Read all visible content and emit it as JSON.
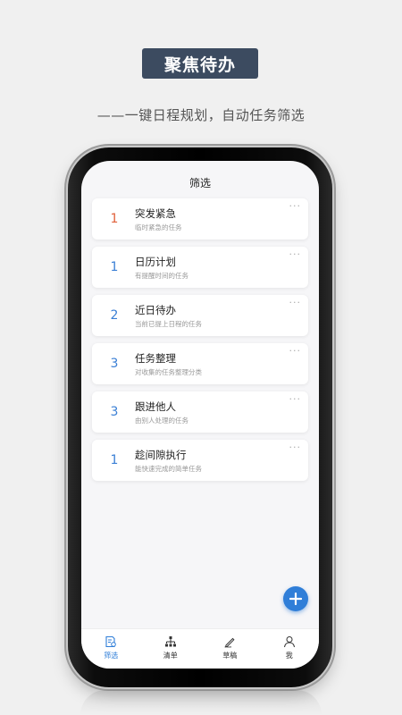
{
  "promo": {
    "title": "聚焦待办",
    "subtitle": "——一键日程规划，自动任务筛选"
  },
  "screen": {
    "title": "筛选"
  },
  "tasks": [
    {
      "count": "1",
      "name": "突发紧急",
      "desc": "临时紧急的任务",
      "count_color": "#e0613a",
      "more": "···"
    },
    {
      "count": "1",
      "name": "日历计划",
      "desc": "有提醒时间的任务",
      "count_color": "#3a7fd5",
      "more": "···"
    },
    {
      "count": "2",
      "name": "近日待办",
      "desc": "当前已提上日程的任务",
      "count_color": "#3a7fd5",
      "more": "···"
    },
    {
      "count": "3",
      "name": "任务整理",
      "desc": "对收集的任务整理分类",
      "count_color": "#3a7fd5",
      "more": "···"
    },
    {
      "count": "3",
      "name": "跟进他人",
      "desc": "由别人处理的任务",
      "count_color": "#3a7fd5",
      "more": "···"
    },
    {
      "count": "1",
      "name": "趁间隙执行",
      "desc": "能快速完成的简单任务",
      "count_color": "#3a7fd5",
      "more": "···"
    }
  ],
  "fab": {
    "icon": "plus-icon"
  },
  "tabbar": [
    {
      "label": "筛选",
      "icon": "filter-doc-icon",
      "active": true
    },
    {
      "label": "清单",
      "icon": "tree-list-icon",
      "active": false
    },
    {
      "label": "草稿",
      "icon": "pen-icon",
      "active": false
    },
    {
      "label": "我",
      "icon": "person-icon",
      "active": false
    }
  ],
  "colors": {
    "accent": "#2f7ed8",
    "badge_bg": "#3c4b60",
    "urgent": "#e0613a"
  }
}
